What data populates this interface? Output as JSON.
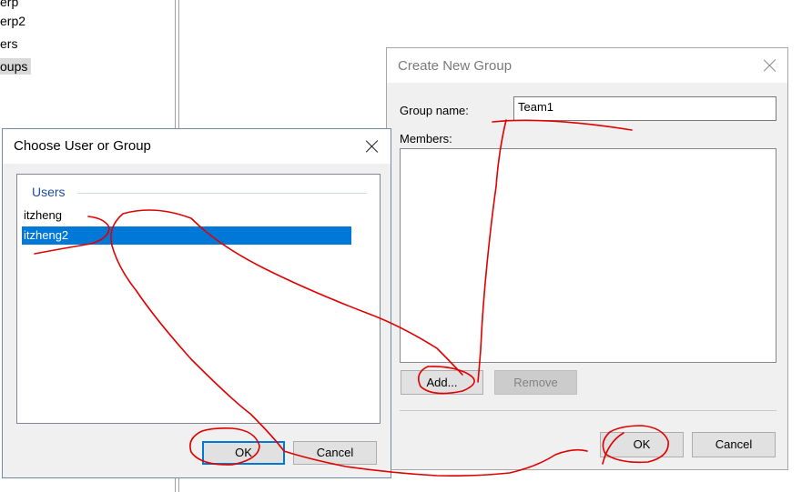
{
  "background_tree": {
    "nodes": [
      "erp",
      "erp2",
      "ers",
      "oups"
    ]
  },
  "choose_dialog": {
    "title": "Choose User or Group",
    "group_title": "Users",
    "items": [
      {
        "label": "itzheng",
        "selected": false
      },
      {
        "label": "itzheng2",
        "selected": true
      }
    ],
    "ok_label": "OK",
    "cancel_label": "Cancel"
  },
  "create_dialog": {
    "title": "Create New Group",
    "group_name_label": "Group name:",
    "group_name_value": "Team1",
    "members_label": "Members:",
    "add_label": "Add...",
    "remove_label": "Remove",
    "ok_label": "OK",
    "cancel_label": "Cancel"
  },
  "colors": {
    "selection": "#0078d7",
    "annotation": "#e00000",
    "dialog_bg": "#f0f0f0"
  },
  "icons": [
    "close-icon"
  ]
}
